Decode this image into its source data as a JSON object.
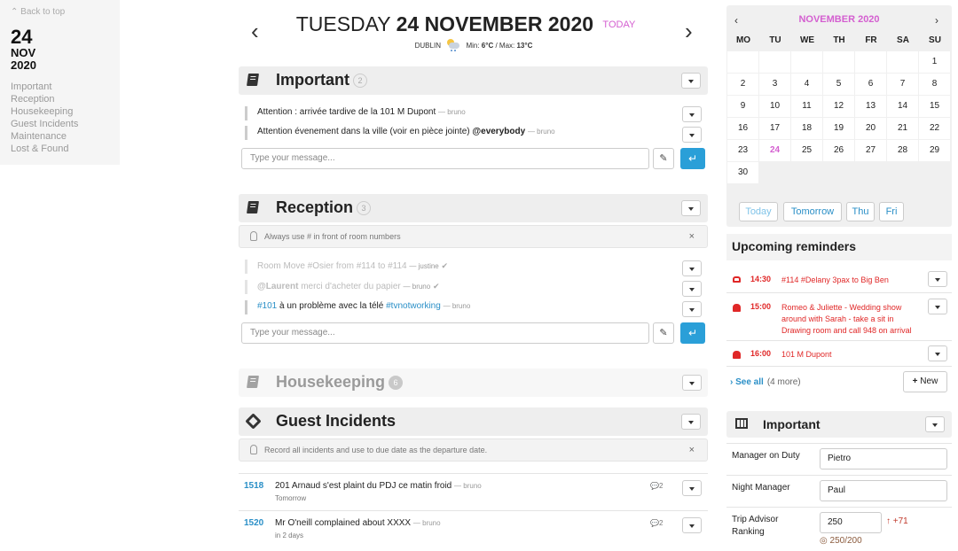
{
  "left": {
    "back_label": "Back to top",
    "day": "24",
    "month": "NOV",
    "year": "2020",
    "nav": [
      "Important",
      "Reception",
      "Housekeeping",
      "Guest Incidents",
      "Maintenance",
      "Lost & Found"
    ]
  },
  "header": {
    "weekday": "TUESDAY",
    "date": "24 NOVEMBER 2020",
    "today": "TODAY",
    "city": "DUBLIN",
    "min_label": "Min:",
    "min": "6°C",
    "max_label": "/ Max:",
    "max": "13°C"
  },
  "important": {
    "title": "Important",
    "count": "2",
    "messages": [
      {
        "text": "Attention : arrivée tardive de la 101 M Dupont",
        "author": "— bruno"
      },
      {
        "text": "Attention évenement dans la ville (voir en pièce jointe)",
        "mention": "@everybody",
        "author": "— bruno"
      }
    ],
    "placeholder": "Type your message..."
  },
  "reception": {
    "title": "Reception",
    "count": "3",
    "note": "Always use # in front of room numbers",
    "messages": [
      {
        "text": "Room Move #Osier from #114 to #114",
        "author": "— justine"
      },
      {
        "mention": "@Laurent",
        "text": "merci d'acheter du papier",
        "author": "— bruno"
      },
      {
        "tag": "#101",
        "text": "à un problème avec la télé",
        "tag2": "#tvnotworking",
        "author": "— bruno"
      }
    ],
    "placeholder": "Type your message..."
  },
  "housekeeping": {
    "title": "Housekeeping",
    "count": "6"
  },
  "incidents": {
    "title": "Guest Incidents",
    "note": "Record all incidents and use to due date as the departure date.",
    "items": [
      {
        "num": "1518",
        "text": "201 Arnaud s'est plaint du PDJ ce matin froid",
        "author": "— bruno",
        "due": "Tomorrow",
        "comments": "2"
      },
      {
        "num": "1520",
        "text": "Mr O'neill complained about XXXX",
        "author": "— bruno",
        "due": "in 2 days",
        "comments": "2"
      }
    ]
  },
  "calendar": {
    "title": "NOVEMBER 2020",
    "weekdays": [
      "MO",
      "TU",
      "WE",
      "TH",
      "FR",
      "SA",
      "SU"
    ],
    "days": [
      "1",
      "2",
      "3",
      "4",
      "5",
      "6",
      "7",
      "8",
      "9",
      "10",
      "11",
      "12",
      "13",
      "14",
      "15",
      "16",
      "17",
      "18",
      "19",
      "20",
      "21",
      "22",
      "23",
      "24",
      "25",
      "26",
      "27",
      "28",
      "29",
      "30"
    ],
    "selected": "24",
    "quick": [
      "Today",
      "Tomorrow",
      "Thu",
      "Fri"
    ]
  },
  "reminders": {
    "title": "Upcoming reminders",
    "items": [
      {
        "icon": "car-icon",
        "time": "14:30",
        "text": "#114 #Delany 3pax to Big Ben"
      },
      {
        "icon": "bell-icon",
        "time": "15:00",
        "text": "Romeo & Juliette - Wedding show around with Sarah - take a sit in Drawing room and call 948 on arrival"
      },
      {
        "icon": "bell-icon",
        "time": "16:00",
        "text": "101 M Dupont"
      }
    ],
    "see_all": "See all",
    "more": "(4 more)",
    "new_label": "New"
  },
  "important_panel": {
    "title": "Important",
    "fields": [
      {
        "label": "Manager on Duty",
        "value": "Pietro"
      },
      {
        "label": "Night Manager",
        "value": "Paul"
      },
      {
        "label": "Trip Advisor Ranking",
        "value": "250",
        "delta": "+71",
        "progress": "250/200"
      }
    ]
  },
  "colors": {
    "accent": "#d45fd0",
    "link": "#2a8fc7",
    "alert": "#e02727",
    "send": "#2a9fd8"
  }
}
